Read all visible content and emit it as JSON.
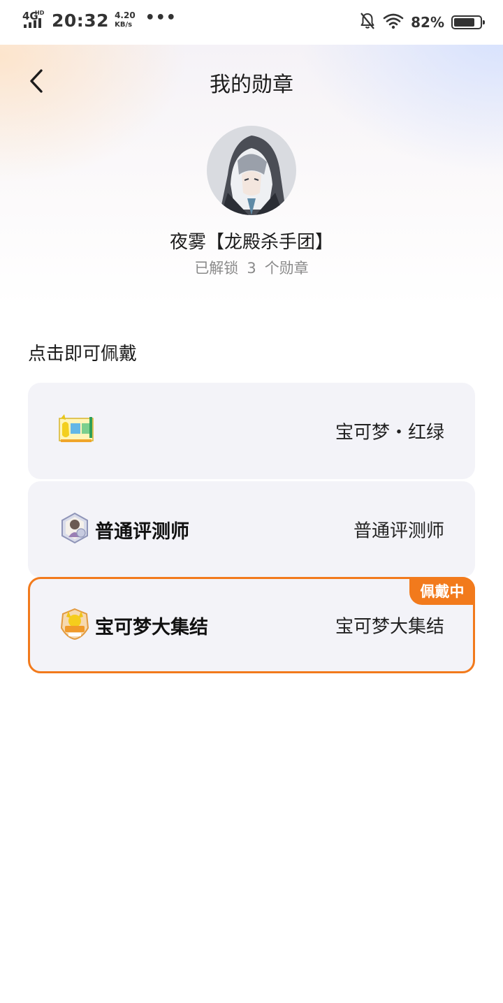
{
  "status_bar": {
    "network": "4G",
    "network_sub": "HD",
    "time": "20:32",
    "speed_value": "4.20",
    "speed_unit": "KB/s",
    "more": "•••",
    "battery_pct": "82%",
    "battery_level": 0.82,
    "icons": [
      "signal-icon",
      "bell-off-icon",
      "wifi-icon",
      "battery-icon"
    ]
  },
  "header": {
    "title": "我的勋章",
    "back_icon": "chevron-left-icon"
  },
  "profile": {
    "name": "夜雾【龙殿杀手团】",
    "unlock_prefix": "已解锁",
    "unlock_count": "3",
    "unlock_suffix": "个勋章"
  },
  "section": {
    "title": "点击即可佩戴"
  },
  "medals": [
    {
      "badge_icon": "pokemon-red-green-badge-icon",
      "badge_label": "",
      "name": "宝可梦・红绿",
      "wearing": false
    },
    {
      "badge_icon": "reviewer-badge-icon",
      "badge_label": "普通评测师",
      "name": "普通评测师",
      "wearing": false
    },
    {
      "badge_icon": "pokemon-unite-badge-icon",
      "badge_label": "宝可梦大集结",
      "name": "宝可梦大集结",
      "wearing": true,
      "wearing_label": "佩戴中"
    }
  ],
  "colors": {
    "accent": "#f27a1c",
    "card_bg": "#f3f3f8",
    "secondary_text": "#8a8a8a"
  }
}
